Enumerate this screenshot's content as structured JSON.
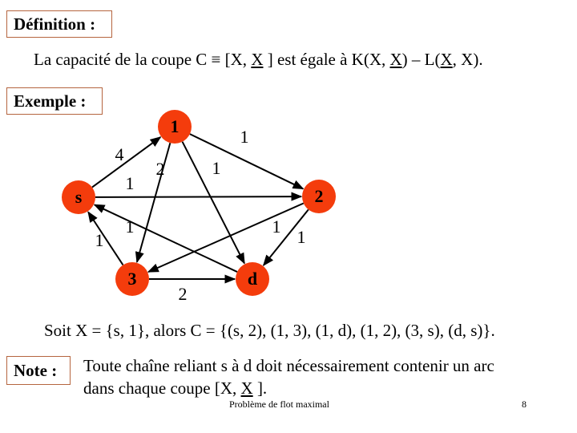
{
  "definition": {
    "heading": "Définition :",
    "text_parts": [
      "La capacité de la coupe C ≡ [X, ",
      "X",
      " ] est égale à K(X, ",
      "X",
      ") – L(",
      "X",
      ", X)."
    ]
  },
  "example": {
    "heading": "Exemple :",
    "node_color": "#f43c0c",
    "nodes": [
      {
        "id": "s",
        "label": "s"
      },
      {
        "id": "1",
        "label": "1"
      },
      {
        "id": "2",
        "label": "2"
      },
      {
        "id": "3",
        "label": "3"
      },
      {
        "id": "d",
        "label": "d"
      }
    ],
    "edges": [
      {
        "from": "s",
        "to": "1",
        "capacity": "4"
      },
      {
        "from": "s",
        "to": "2",
        "capacity": "1"
      },
      {
        "from": "1",
        "to": "2",
        "capacity": "1"
      },
      {
        "from": "1",
        "to": "3",
        "capacity": "2"
      },
      {
        "from": "1",
        "to": "d",
        "capacity": "1"
      },
      {
        "from": "2",
        "to": "3",
        "capacity": "1"
      },
      {
        "from": "2",
        "to": "d",
        "capacity": "1"
      },
      {
        "from": "3",
        "to": "s",
        "capacity": "1"
      },
      {
        "from": "d",
        "to": "s",
        "capacity": "1"
      },
      {
        "from": "3",
        "to": "d",
        "capacity": "2"
      }
    ],
    "statement": "Soit X = {s, 1}, alors C = {(s, 2), (1, 3), (1, d), (1, 2), (3, s), (d, s)}."
  },
  "note": {
    "heading": "Note :",
    "line1": "Toute chaîne reliant s à d doit nécessairement contenir un arc",
    "line2_parts": [
      "dans chaque coupe [X, ",
      "X",
      " ]."
    ]
  },
  "footer": {
    "title": "Problème de flot maximal",
    "page": "8"
  }
}
